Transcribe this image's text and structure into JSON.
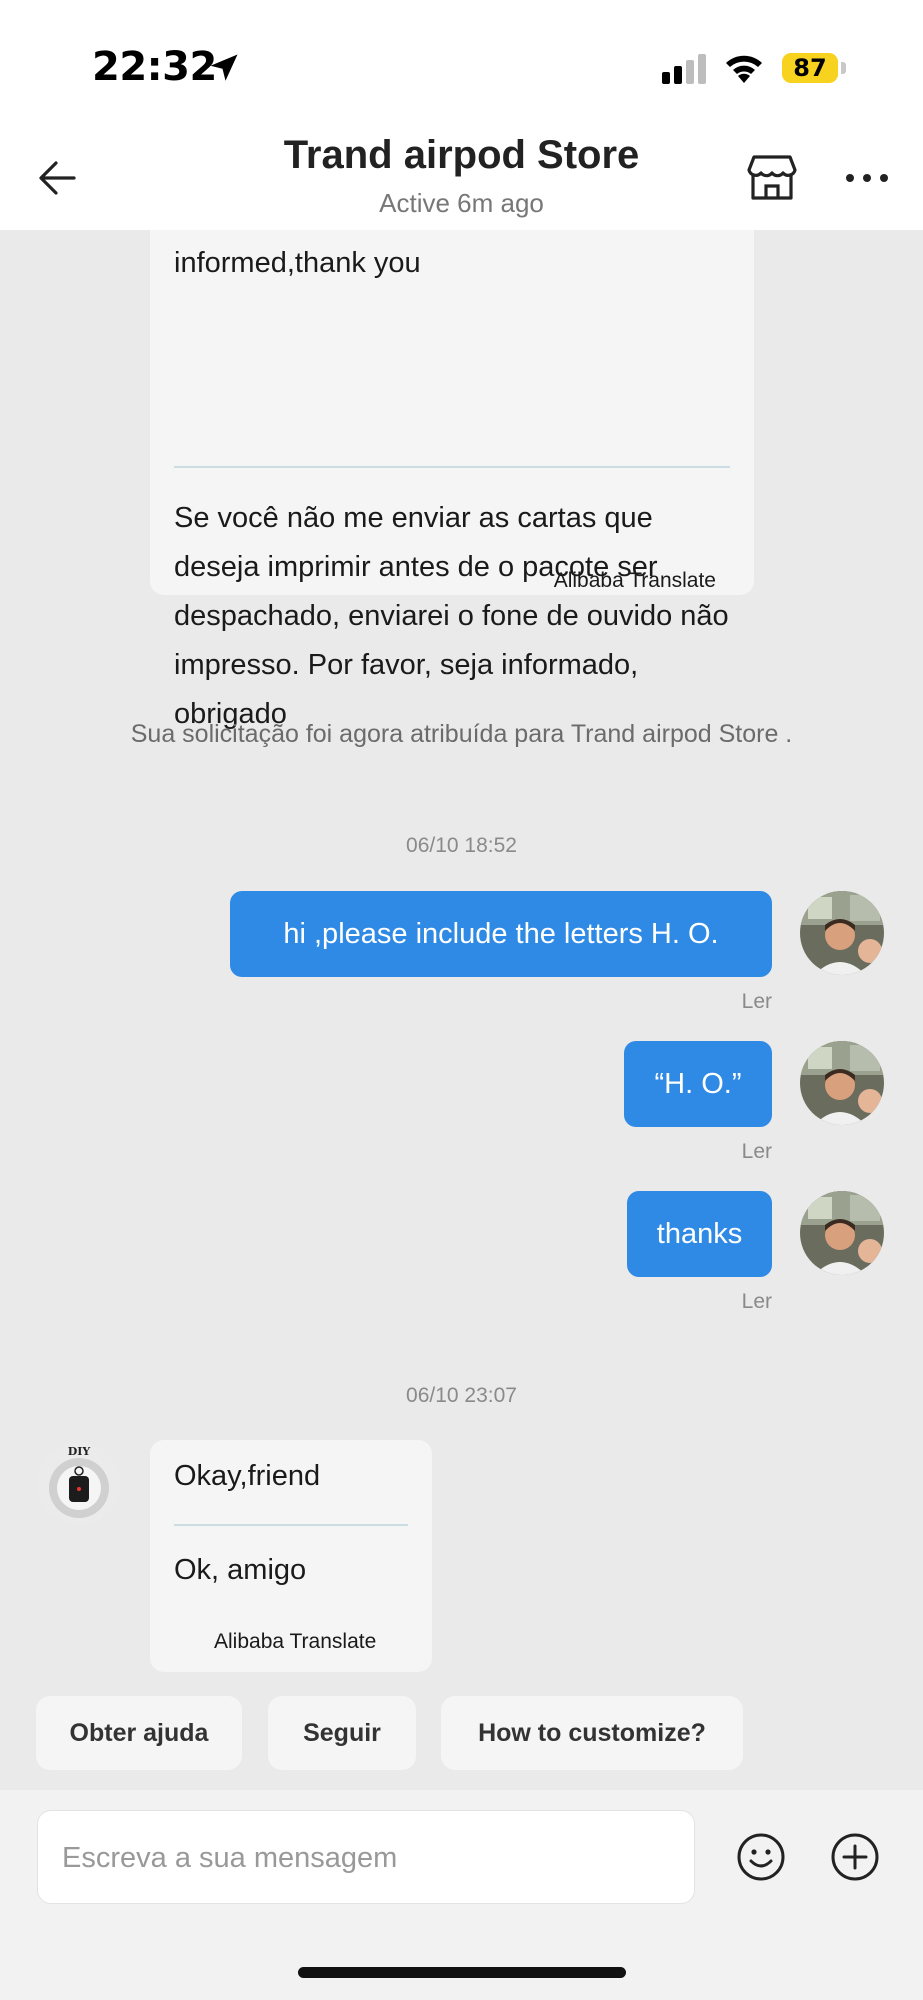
{
  "status_bar": {
    "time": "22:32",
    "battery": "87"
  },
  "header": {
    "title": "Trand airpod Store",
    "subtitle": "Active 6m ago"
  },
  "messages": {
    "top_card": {
      "original": "unprinted earphone case.Please be informed,thank you",
      "translation": "Se você não me enviar as cartas que deseja imprimir antes de o pacote ser despachado, enviarei o fone de ouvido não impresso. Por favor, seja informado, obrigado",
      "attribution": "Alibaba Translate"
    },
    "system": "Sua solicitação foi agora atribuída para Trand airpod Store .",
    "timestamp_1": "06/10 18:52",
    "outgoing": [
      {
        "text": "hi ,please include the letters H. O.",
        "status": "Ler"
      },
      {
        "text": "“H. O.”",
        "status": "Ler"
      },
      {
        "text": "thanks",
        "status": "Ler"
      }
    ],
    "timestamp_2": "06/10 23:07",
    "bottom_card": {
      "avatar_label": "DIY",
      "original": "Okay,friend",
      "translation": "Ok, amigo",
      "attribution": "Alibaba Translate"
    }
  },
  "quick_replies": [
    "Obter ajuda",
    "Seguir",
    "How to customize?"
  ],
  "composer": {
    "placeholder": "Escreva a sua mensagem"
  },
  "colors": {
    "accent": "#2f8ae6",
    "battery": "#f7d21e"
  }
}
